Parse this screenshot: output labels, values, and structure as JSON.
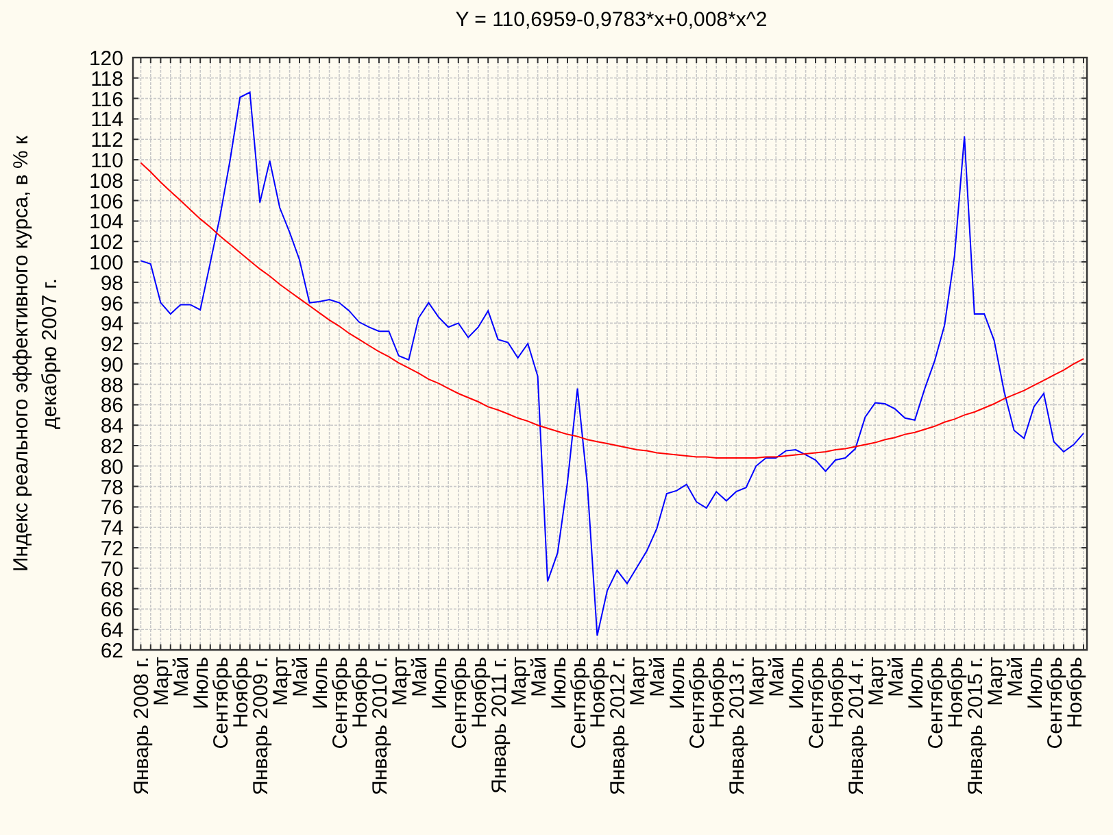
{
  "chart": {
    "chart_data": {
      "type": "line",
      "title": "Y = 110,6959-0,9783*x+0,008*x^2",
      "ylabel": "Индекс реального эффективного курса, в % к декабрю 2007 г.",
      "ylim": [
        62,
        120
      ],
      "grid": true,
      "yticks": [
        62,
        64,
        66,
        68,
        70,
        72,
        74,
        76,
        78,
        80,
        82,
        84,
        86,
        88,
        90,
        92,
        94,
        96,
        98,
        100,
        102,
        104,
        106,
        108,
        110,
        112,
        114,
        116,
        118,
        120
      ],
      "categories": [
        "Январь 2008 г.",
        null,
        "Март",
        null,
        "Май",
        null,
        "Июль",
        null,
        "Сентябрь",
        null,
        "Ноябрь",
        null,
        "Январь 2009 г.",
        null,
        "Март",
        null,
        "Май",
        null,
        "Июль",
        null,
        "Сентябрь",
        null,
        "Ноябрь",
        null,
        "Январь 2010 г.",
        null,
        "Март",
        null,
        "Май",
        null,
        "Июль",
        null,
        "Сентябрь",
        null,
        "Ноябрь",
        null,
        "Январь 2011 г.",
        null,
        "Март",
        null,
        "Май",
        null,
        "Июль",
        null,
        "Сентябрь",
        null,
        "Ноябрь",
        null,
        "Январь 2012 г.",
        null,
        "Март",
        null,
        "Май",
        null,
        "Июль",
        null,
        "Сентябрь",
        null,
        "Ноябрь",
        null,
        "Январь 2013 г.",
        null,
        "Март",
        null,
        "Май",
        null,
        "Июль",
        null,
        "Сентябрь",
        null,
        "Ноябрь",
        null,
        "Январь 2014 г.",
        null,
        "Март",
        null,
        "Май",
        null,
        "Июль",
        null,
        "Сентябрь",
        null,
        "Ноябрь",
        null,
        "Январь 2015 г.",
        null,
        "Март",
        null,
        "Май",
        null,
        "Июль",
        null,
        "Сентябрь",
        null,
        "Ноябрь",
        null
      ],
      "series": [
        {
          "color": "#0000ff",
          "values": [
            100.1,
            99.8,
            96.0,
            94.9,
            95.8,
            95.8,
            95.3,
            99.9,
            104.5,
            110.0,
            116.1,
            116.6,
            105.8,
            109.9,
            105.3,
            102.9,
            100.2,
            96.0,
            96.1,
            96.3,
            96.0,
            95.2,
            94.1,
            93.6,
            93.2,
            93.2,
            90.8,
            90.4,
            94.5,
            96.0,
            94.6,
            93.6,
            94.0,
            92.6,
            93.6,
            95.2,
            92.4,
            92.1,
            90.6,
            92.0,
            88.8,
            68.7,
            71.5,
            78.4,
            87.6,
            78.2,
            63.4,
            67.8,
            69.8,
            68.5,
            70.1,
            71.7,
            73.9,
            77.3,
            77.6,
            78.2,
            76.5,
            75.9,
            77.5,
            76.6,
            77.5,
            77.9,
            80.0,
            80.8,
            80.8,
            81.5,
            81.6,
            81.1,
            80.6,
            79.5,
            80.6,
            80.8,
            81.7,
            84.8,
            86.2,
            86.1,
            85.6,
            84.7,
            84.5,
            87.6,
            90.3,
            93.8,
            100.6,
            112.3,
            94.9,
            94.9,
            92.3,
            87.3,
            83.5,
            82.7,
            85.8,
            87.1,
            82.4,
            81.4,
            82.1,
            83.2
          ]
        },
        {
          "color": "#ff0000",
          "values": [
            109.7,
            108.8,
            107.8,
            106.9,
            106.0,
            105.1,
            104.2,
            103.4,
            102.5,
            101.7,
            100.9,
            100.1,
            99.3,
            98.6,
            97.8,
            97.1,
            96.4,
            95.7,
            95.0,
            94.3,
            93.7,
            93.0,
            92.4,
            91.8,
            91.2,
            90.7,
            90.1,
            89.6,
            89.1,
            88.5,
            88.1,
            87.6,
            87.1,
            86.7,
            86.3,
            85.8,
            85.5,
            85.1,
            84.7,
            84.4,
            84.0,
            83.7,
            83.4,
            83.1,
            82.9,
            82.6,
            82.4,
            82.2,
            82.0,
            81.8,
            81.6,
            81.5,
            81.3,
            81.2,
            81.1,
            81.0,
            80.9,
            80.9,
            80.8,
            80.8,
            80.8,
            80.8,
            80.8,
            80.9,
            80.9,
            81.0,
            81.1,
            81.2,
            81.3,
            81.4,
            81.6,
            81.7,
            81.9,
            82.1,
            82.3,
            82.6,
            82.8,
            83.1,
            83.3,
            83.6,
            83.9,
            84.3,
            84.6,
            85.0,
            85.3,
            85.7,
            86.1,
            86.6,
            87.0,
            87.4,
            87.9,
            88.4,
            88.9,
            89.4,
            90.0,
            90.5
          ]
        }
      ]
    }
  }
}
